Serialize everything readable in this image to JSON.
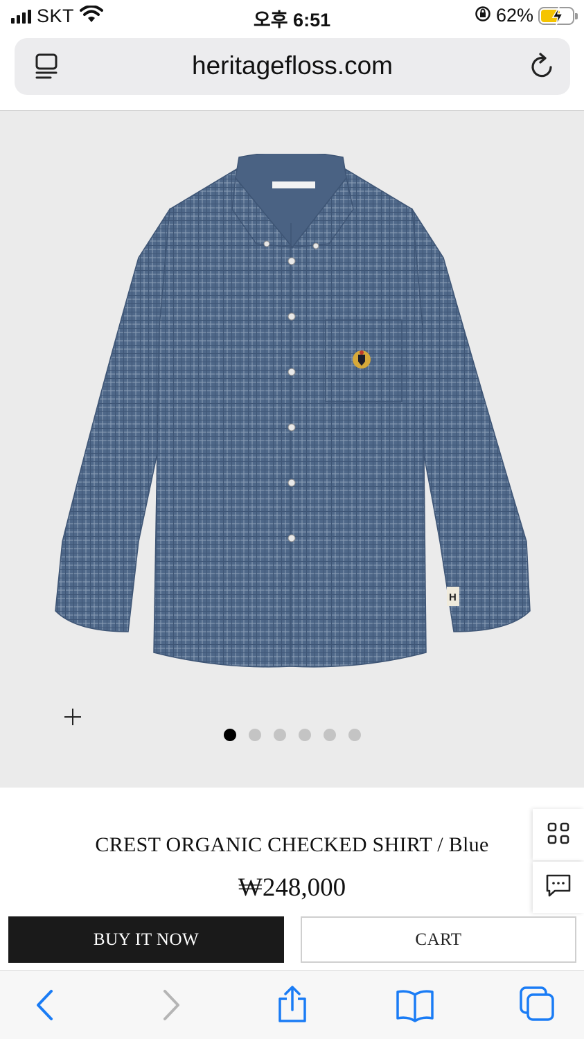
{
  "status_bar": {
    "carrier": "SKT",
    "time": "오후 6:51",
    "battery_percent": "62%",
    "icons": [
      "signal-icon",
      "wifi-icon",
      "rotation-lock-icon",
      "battery-charging-icon"
    ]
  },
  "browser": {
    "url": "heritagefloss.com",
    "icons": [
      "reader-icon",
      "reload-icon"
    ]
  },
  "gallery": {
    "slide_count": 6,
    "active_slide": 1,
    "zoom_icon": "plus-icon"
  },
  "product": {
    "name": "CREST ORGANIC CHECKED SHIRT / Blue",
    "price": "₩248,000"
  },
  "actions": {
    "buy_now_label": "BUY IT NOW",
    "cart_label": "CART"
  },
  "floating": [
    "grid-icon",
    "chat-icon"
  ],
  "toolbar": [
    "back-icon",
    "forward-icon",
    "share-icon",
    "bookmarks-icon",
    "tabs-icon"
  ],
  "colors": {
    "accent_dark": "#1a1a1a",
    "shirt_blue": "#4f6889",
    "ios_blue": "#1a7cf5",
    "gallery_bg": "#ebebeb"
  }
}
